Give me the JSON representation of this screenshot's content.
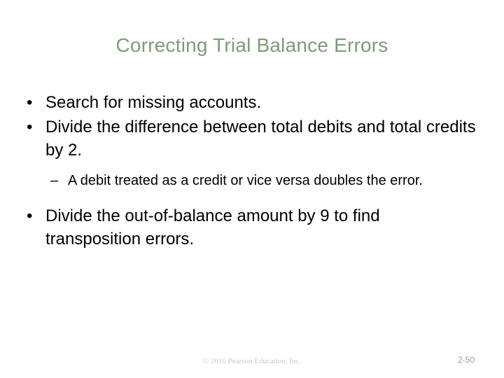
{
  "slide": {
    "title": "Correcting Trial Balance Errors",
    "title_color": "#7d9b78",
    "background_color": "#ffffff",
    "body_text_color": "#000000",
    "bullets": [
      {
        "level": 1,
        "marker": "•",
        "text": "Search for missing accounts."
      },
      {
        "level": 1,
        "marker": "•",
        "text": "Divide the difference between total debits and total credits by 2."
      },
      {
        "level": 2,
        "marker": "–",
        "text": "A debit treated as a credit or vice versa doubles the error."
      },
      {
        "level": 1,
        "marker": "•",
        "text": "Divide the out-of-balance amount by 9 to find transposition errors."
      }
    ],
    "footer": {
      "copyright": "© 2016 Pearson Education, Inc.",
      "copyright_color": "#c9c9c9",
      "slide_number": "2-50",
      "slide_number_color": "#9a9a9a"
    }
  }
}
